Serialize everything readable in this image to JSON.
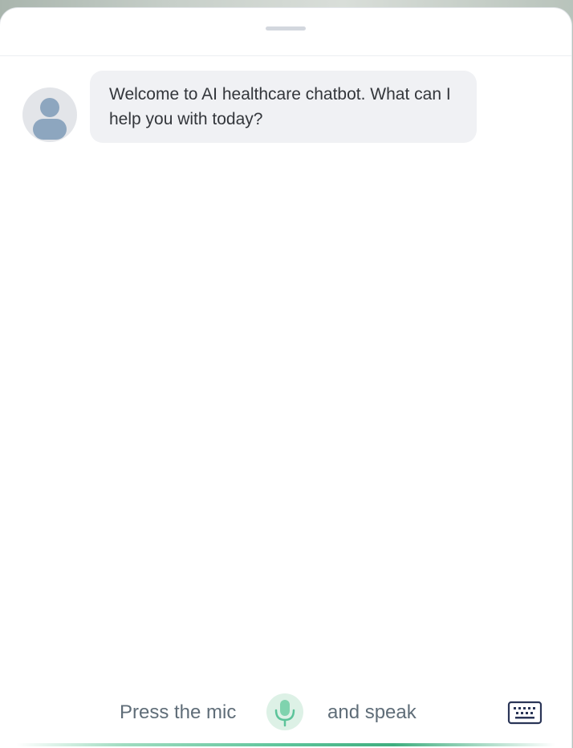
{
  "chat": {
    "messages": [
      {
        "role": "bot",
        "text": "Welcome to AI healthcare chatbot. What can I help you with today?",
        "avatar_icon": "user-silhouette-icon"
      }
    ]
  },
  "voice": {
    "hint_before": "Press the mic",
    "hint_after": "and speak",
    "mic_icon": "microphone-icon",
    "keyboard_icon": "keyboard-icon"
  },
  "colors": {
    "bubble_bg": "#f0f1f4",
    "mic_green": "#5cc49a",
    "mic_bg": "#ddf1e6",
    "keyboard_navy": "#2a3557",
    "hint_text": "#5f6d78"
  }
}
